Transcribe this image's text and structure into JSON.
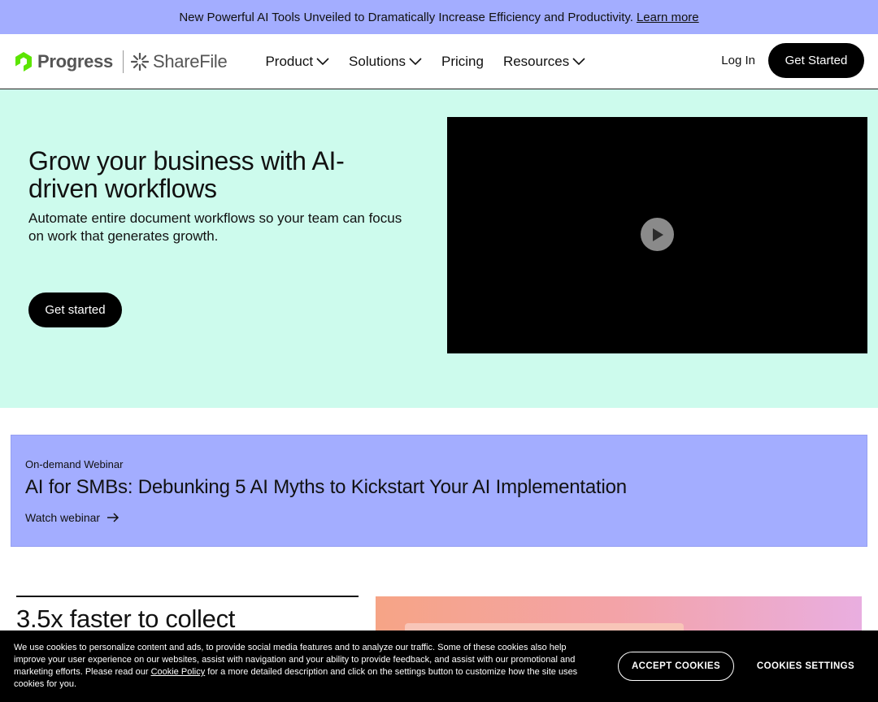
{
  "announcement": {
    "text": "New Powerful AI Tools Unveiled to Dramatically Increase Efficiency and Productivity.",
    "link": "Learn more"
  },
  "header": {
    "logo_progress": "Progress",
    "logo_sharefile": "ShareFile",
    "menu": [
      {
        "label": "Product",
        "has_dropdown": true
      },
      {
        "label": "Solutions",
        "has_dropdown": true
      },
      {
        "label": "Pricing",
        "has_dropdown": false
      },
      {
        "label": "Resources",
        "has_dropdown": true
      }
    ],
    "login": "Log In",
    "cta": "Get Started"
  },
  "hero": {
    "title": "Grow your business with AI-driven workflows",
    "subtitle_line1": "Automate entire document workflows so your team can focus",
    "subtitle_line2": "on work that generates growth.",
    "cta": "Get started",
    "video_icon": "play-icon"
  },
  "webinar": {
    "tag": "On-demand Webinar",
    "title": "AI for SMBs: Debunking 5 AI Myths to Kickstart Your AI Implementation",
    "link": "Watch webinar",
    "link_icon": "arrow-right-icon"
  },
  "stats": {
    "headline": "3.5x faster to collect"
  },
  "cookie_banner": {
    "text_before": "We use cookies to personalize content and ads, to provide social media features and to analyze our traffic. Some of these cookies also help improve your user experience on our websites, assist with navigation and your ability to provide feedback, and assist with our promotional and marketing efforts. Please read our",
    "policy_link": "Cookie Policy",
    "text_after": "for a more detailed description and click on the settings button to customize how the site uses cookies for you.",
    "accept": "ACCEPT COOKIES",
    "settings": "COOKIES SETTINGS"
  },
  "colors": {
    "announcement_bg": "#a3adff",
    "hero_bg": "#cdfbed",
    "webinar_bg": "#a3adff",
    "button_bg": "#000000",
    "logo_green": "#5ce500"
  }
}
